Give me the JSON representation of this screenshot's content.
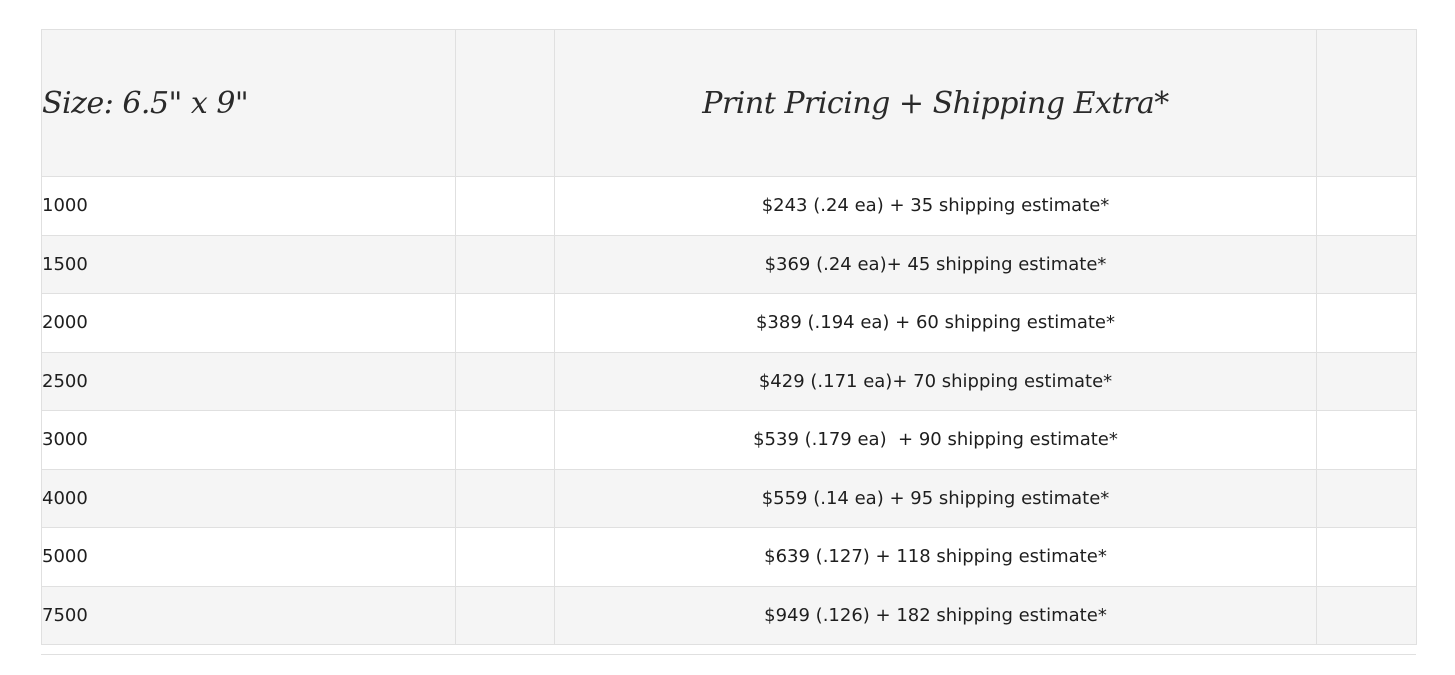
{
  "table": {
    "header": {
      "size": "Size: 6.5\" x 9\"",
      "blank1": "",
      "pricing": "Print Pricing + Shipping Extra*",
      "blank2": ""
    },
    "rows": [
      {
        "qty": "1000",
        "price": "$243 (.24 ea) + 35 shipping estimate*"
      },
      {
        "qty": "1500",
        "price": "$369 (.24 ea)+ 45 shipping estimate*"
      },
      {
        "qty": "2000",
        "price": "$389 (.194 ea) + 60 shipping estimate*"
      },
      {
        "qty": "2500",
        "price": "$429 (.171 ea)+ 70 shipping estimate*"
      },
      {
        "qty": "3000",
        "price": "$539 (.179 ea)  + 90 shipping estimate*"
      },
      {
        "qty": "4000",
        "price": "$559 (.14 ea) + 95 shipping estimate*"
      },
      {
        "qty": "5000",
        "price": "$639 (.127) + 118 shipping estimate*"
      },
      {
        "qty": "7500",
        "price": "$949 (.126) + 182 shipping estimate*"
      }
    ]
  }
}
